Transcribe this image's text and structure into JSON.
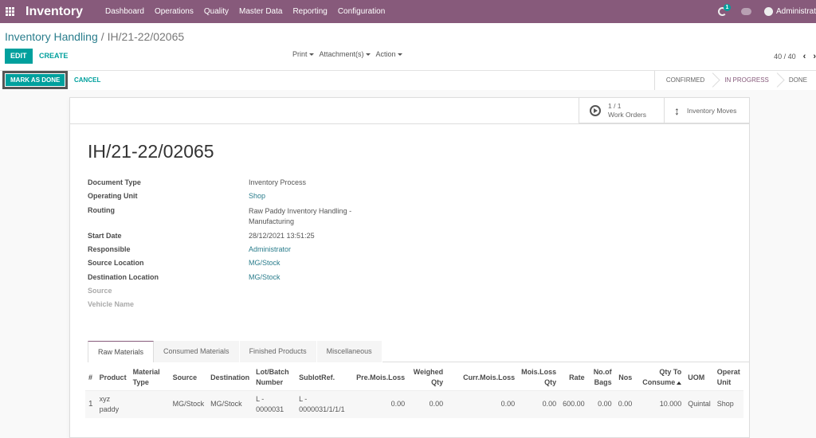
{
  "topbar": {
    "app_name": "Inventory",
    "menu": [
      "Dashboard",
      "Operations",
      "Quality",
      "Master Data",
      "Reporting",
      "Configuration"
    ],
    "activity_badge": "1",
    "user_name": "Administrat",
    "icons": [
      "apps-grid-icon",
      "activity-clock-icon",
      "chat-icon",
      "user-avatar-icon"
    ],
    "color": "#875a7b"
  },
  "breadcrumb": {
    "parent": "Inventory Handling",
    "separator": "/",
    "current": "IH/21-22/02065"
  },
  "toolbar": {
    "edit_label": "EDIT",
    "create_label": "CREATE",
    "print_label": "Print",
    "attachments_label": "Attachment(s)",
    "action_label": "Action",
    "pager": "40 / 40",
    "prev": "‹",
    "next": "›"
  },
  "statusbar": {
    "mark_done_label": "MARK AS DONE",
    "cancel_label": "CANCEL",
    "stages": [
      "CONFIRMED",
      "IN PROGRESS",
      "DONE"
    ],
    "active_stage": "IN PROGRESS"
  },
  "smart_buttons": {
    "work_orders_count": "1 / 1",
    "work_orders_label": "Work Orders",
    "inventory_moves_label": "Inventory Moves"
  },
  "record": {
    "title": "IH/21-22/02065",
    "fields": [
      {
        "label": "Document Type",
        "value": "Inventory Process",
        "link": false
      },
      {
        "label": "Operating Unit",
        "value": "Shop",
        "link": true
      },
      {
        "label": "Routing",
        "value": "Raw Paddy Inventory Handling - Manufacturing",
        "link": false
      },
      {
        "label": "Start Date",
        "value": "28/12/2021 13:51:25",
        "link": false
      },
      {
        "label": "Responsible",
        "value": "Administrator",
        "link": true
      },
      {
        "label": "Source Location",
        "value": "MG/Stock",
        "link": true
      },
      {
        "label": "Destination Location",
        "value": "MG/Stock",
        "link": true
      },
      {
        "label": "Source",
        "value": "",
        "link": false
      },
      {
        "label": "Vehicle Name",
        "value": "",
        "link": false
      }
    ]
  },
  "tabs": [
    "Raw Materials",
    "Consumed Materials",
    "Finished Products",
    "Miscellaneous"
  ],
  "active_tab": "Raw Materials",
  "table": {
    "headers": [
      "#",
      "Product",
      "Material Type",
      "Source",
      "Destination",
      "Lot/Batch Number",
      "SublotRef.",
      "Pre.Mois.Loss",
      "Weighed Qty",
      "Curr.Mois.Loss",
      "Mois.Loss Qty",
      "Rate",
      "No.of Bags",
      "Nos",
      "Qty To Consume",
      "UOM",
      "Operat Unit"
    ],
    "sorted_column": "Qty To Consume",
    "rows": [
      [
        "1",
        "xyz paddy",
        "",
        "MG/Stock",
        "MG/Stock",
        "L - 0000031",
        "L - 0000031/1/1/1",
        "0.00",
        "0.00",
        "0.00",
        "0.00",
        "600.00",
        "0.00",
        "0.00",
        "10.000",
        "Quintal",
        "Shop"
      ]
    ]
  }
}
